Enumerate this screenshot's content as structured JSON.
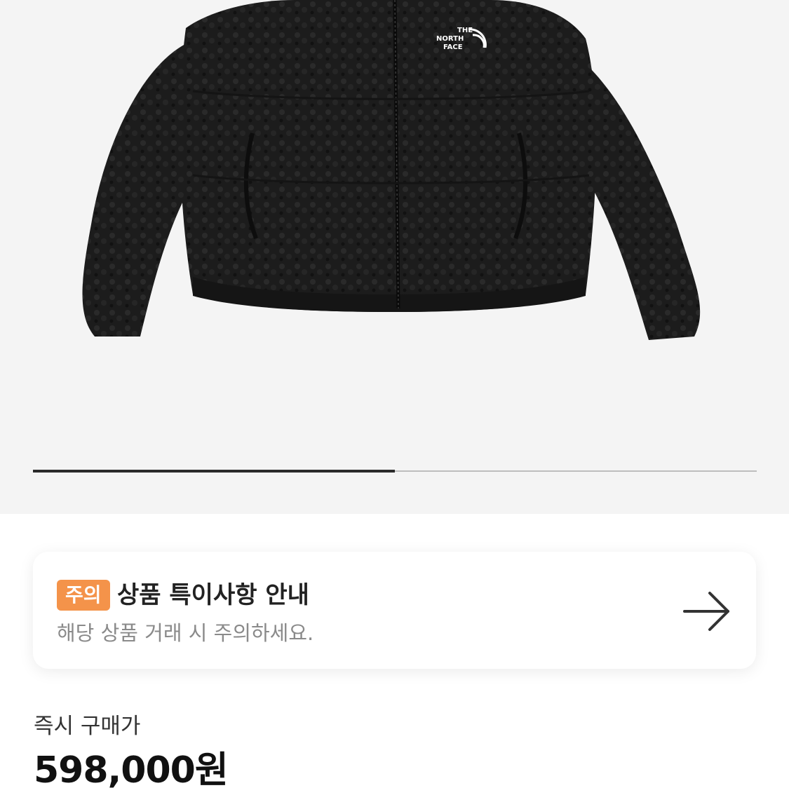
{
  "gallery": {
    "image_alt": "black fleece jacket",
    "logo_text": [
      "THE",
      "NORTH",
      "FACE"
    ],
    "progress_fraction": 0.5
  },
  "notice": {
    "badge": "주의",
    "title": "상품 특이사항 안내",
    "subtitle": "해당 상품 거래 시 주의하세요.",
    "action_icon": "arrow-right-icon"
  },
  "price": {
    "label": "즉시 구매가",
    "value": "598,000원"
  },
  "colors": {
    "badge": "#f4934a",
    "gallery_bg": "#f4f4f4",
    "progress_fill": "#2a2a2a",
    "progress_track": "#bdbdbd"
  }
}
